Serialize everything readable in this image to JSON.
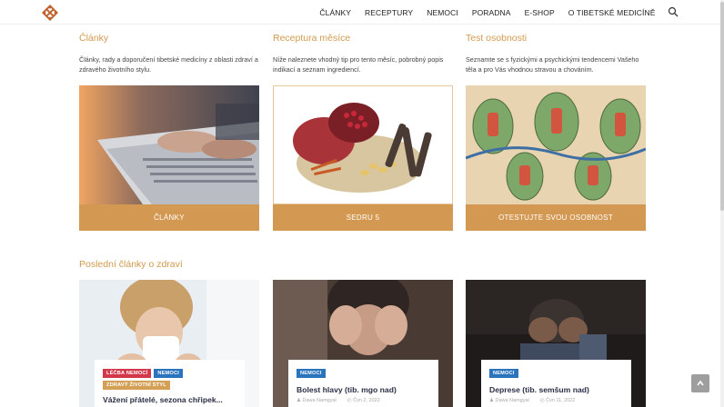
{
  "nav": {
    "items": [
      "ČLÁNKY",
      "RECEPTURY",
      "NEMOCI",
      "PORADNA",
      "E-SHOP",
      "O TIBETSKÉ MEDICÍNĚ"
    ]
  },
  "features": [
    {
      "title": "Články",
      "desc": "Články, rady a doporučení tibetské medicíny z oblasti zdraví a zdravého životního stylu.",
      "button": "ČLÁNKY"
    },
    {
      "title": "Receptura měsíce",
      "desc": "Níže naleznete vhodný tip pro tento měsíc, pobrobný popis indikací a seznam ingrediencí.",
      "button": "SEDRU 5"
    },
    {
      "title": "Test osobnosti",
      "desc": "Seznamte se s fyzickými a psychickými tendencemi Vašeho těla a pro Vás vhodnou stravou a chováním.",
      "button": "OTESTUJTE SVOU OSOBNOST"
    }
  ],
  "latest": {
    "title": "Poslední články o zdraví",
    "cards": [
      {
        "tags": [
          "LÉČBA NEMOCÍ",
          "NEMOCI",
          "ZDRAVÝ ŽIVOTNÍ STYL"
        ],
        "title": "Vážení přátelé, sezona chřipek...",
        "author": "",
        "date": ""
      },
      {
        "tags": [
          "NEMOCI"
        ],
        "title": "Bolest hlavy (tib. mgo nad)",
        "author": "Dawa Namgyal",
        "date": "Čvn 2, 2022"
      },
      {
        "tags": [
          "NEMOCI"
        ],
        "title": "Deprese (tib. semšum nad)",
        "author": "Dawa Namgyal",
        "date": "Čvn 11, 2022"
      }
    ]
  },
  "colors": {
    "accent": "#d39852",
    "title": "#d09a4e",
    "tag_red": "#d2384a",
    "tag_blue": "#2a73bd",
    "tag_gold": "#d4a056"
  }
}
